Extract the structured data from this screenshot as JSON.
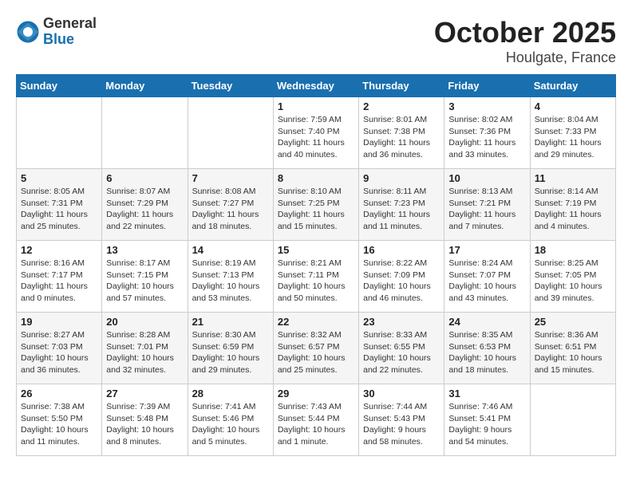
{
  "header": {
    "logo": {
      "general": "General",
      "blue": "Blue"
    },
    "title": "October 2025",
    "subtitle": "Houlgate, France"
  },
  "calendar": {
    "days_of_week": [
      "Sunday",
      "Monday",
      "Tuesday",
      "Wednesday",
      "Thursday",
      "Friday",
      "Saturday"
    ],
    "weeks": [
      [
        {
          "day": "",
          "info": ""
        },
        {
          "day": "",
          "info": ""
        },
        {
          "day": "",
          "info": ""
        },
        {
          "day": "1",
          "info": "Sunrise: 7:59 AM\nSunset: 7:40 PM\nDaylight: 11 hours and 40 minutes."
        },
        {
          "day": "2",
          "info": "Sunrise: 8:01 AM\nSunset: 7:38 PM\nDaylight: 11 hours and 36 minutes."
        },
        {
          "day": "3",
          "info": "Sunrise: 8:02 AM\nSunset: 7:36 PM\nDaylight: 11 hours and 33 minutes."
        },
        {
          "day": "4",
          "info": "Sunrise: 8:04 AM\nSunset: 7:33 PM\nDaylight: 11 hours and 29 minutes."
        }
      ],
      [
        {
          "day": "5",
          "info": "Sunrise: 8:05 AM\nSunset: 7:31 PM\nDaylight: 11 hours and 25 minutes."
        },
        {
          "day": "6",
          "info": "Sunrise: 8:07 AM\nSunset: 7:29 PM\nDaylight: 11 hours and 22 minutes."
        },
        {
          "day": "7",
          "info": "Sunrise: 8:08 AM\nSunset: 7:27 PM\nDaylight: 11 hours and 18 minutes."
        },
        {
          "day": "8",
          "info": "Sunrise: 8:10 AM\nSunset: 7:25 PM\nDaylight: 11 hours and 15 minutes."
        },
        {
          "day": "9",
          "info": "Sunrise: 8:11 AM\nSunset: 7:23 PM\nDaylight: 11 hours and 11 minutes."
        },
        {
          "day": "10",
          "info": "Sunrise: 8:13 AM\nSunset: 7:21 PM\nDaylight: 11 hours and 7 minutes."
        },
        {
          "day": "11",
          "info": "Sunrise: 8:14 AM\nSunset: 7:19 PM\nDaylight: 11 hours and 4 minutes."
        }
      ],
      [
        {
          "day": "12",
          "info": "Sunrise: 8:16 AM\nSunset: 7:17 PM\nDaylight: 11 hours and 0 minutes."
        },
        {
          "day": "13",
          "info": "Sunrise: 8:17 AM\nSunset: 7:15 PM\nDaylight: 10 hours and 57 minutes."
        },
        {
          "day": "14",
          "info": "Sunrise: 8:19 AM\nSunset: 7:13 PM\nDaylight: 10 hours and 53 minutes."
        },
        {
          "day": "15",
          "info": "Sunrise: 8:21 AM\nSunset: 7:11 PM\nDaylight: 10 hours and 50 minutes."
        },
        {
          "day": "16",
          "info": "Sunrise: 8:22 AM\nSunset: 7:09 PM\nDaylight: 10 hours and 46 minutes."
        },
        {
          "day": "17",
          "info": "Sunrise: 8:24 AM\nSunset: 7:07 PM\nDaylight: 10 hours and 43 minutes."
        },
        {
          "day": "18",
          "info": "Sunrise: 8:25 AM\nSunset: 7:05 PM\nDaylight: 10 hours and 39 minutes."
        }
      ],
      [
        {
          "day": "19",
          "info": "Sunrise: 8:27 AM\nSunset: 7:03 PM\nDaylight: 10 hours and 36 minutes."
        },
        {
          "day": "20",
          "info": "Sunrise: 8:28 AM\nSunset: 7:01 PM\nDaylight: 10 hours and 32 minutes."
        },
        {
          "day": "21",
          "info": "Sunrise: 8:30 AM\nSunset: 6:59 PM\nDaylight: 10 hours and 29 minutes."
        },
        {
          "day": "22",
          "info": "Sunrise: 8:32 AM\nSunset: 6:57 PM\nDaylight: 10 hours and 25 minutes."
        },
        {
          "day": "23",
          "info": "Sunrise: 8:33 AM\nSunset: 6:55 PM\nDaylight: 10 hours and 22 minutes."
        },
        {
          "day": "24",
          "info": "Sunrise: 8:35 AM\nSunset: 6:53 PM\nDaylight: 10 hours and 18 minutes."
        },
        {
          "day": "25",
          "info": "Sunrise: 8:36 AM\nSunset: 6:51 PM\nDaylight: 10 hours and 15 minutes."
        }
      ],
      [
        {
          "day": "26",
          "info": "Sunrise: 7:38 AM\nSunset: 5:50 PM\nDaylight: 10 hours and 11 minutes."
        },
        {
          "day": "27",
          "info": "Sunrise: 7:39 AM\nSunset: 5:48 PM\nDaylight: 10 hours and 8 minutes."
        },
        {
          "day": "28",
          "info": "Sunrise: 7:41 AM\nSunset: 5:46 PM\nDaylight: 10 hours and 5 minutes."
        },
        {
          "day": "29",
          "info": "Sunrise: 7:43 AM\nSunset: 5:44 PM\nDaylight: 10 hours and 1 minute."
        },
        {
          "day": "30",
          "info": "Sunrise: 7:44 AM\nSunset: 5:43 PM\nDaylight: 9 hours and 58 minutes."
        },
        {
          "day": "31",
          "info": "Sunrise: 7:46 AM\nSunset: 5:41 PM\nDaylight: 9 hours and 54 minutes."
        },
        {
          "day": "",
          "info": ""
        }
      ]
    ]
  }
}
